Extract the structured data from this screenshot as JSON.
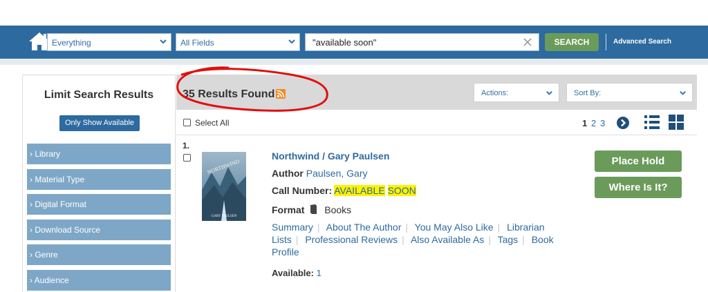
{
  "search_bar": {
    "scope_value": "Everything",
    "field_value": "All Fields",
    "query_value": "\"available soon\"",
    "search_label": "SEARCH",
    "advanced_label": "Advanced Search"
  },
  "sidebar": {
    "title": "Limit Search Results",
    "only_available_label": "Only Show Available",
    "facets": [
      "› Library",
      "› Material Type",
      "› Digital Format",
      "› Download Source",
      "› Genre",
      "› Audience"
    ]
  },
  "results": {
    "count_label": "35 Results Found",
    "actions_label": "Actions:",
    "sort_label": "Sort By:",
    "select_all_label": "Select All",
    "pages": [
      "1",
      "2",
      "3"
    ],
    "current_page": "1"
  },
  "item": {
    "number": "1.",
    "title": "Northwind / Gary Paulsen",
    "author_label": "Author",
    "author_value": "Paulsen, Gary",
    "call_number_label": "Call Number:",
    "call_number_word1": "AVAILABLE",
    "call_number_word2": "SOON",
    "format_label": "Format",
    "format_value": "Books",
    "links": [
      "Summary",
      "About The Author",
      "You May Also Like",
      "Librarian Lists",
      "Professional Reviews",
      "Also Available As",
      "Tags",
      "Book Profile"
    ],
    "available_label": "Available:",
    "available_value": "1",
    "place_hold_label": "Place Hold",
    "where_is_it_label": "Where Is It?",
    "cover_title_text": "NORTHWIND",
    "cover_author_text": "GARY PAULSEN"
  },
  "colors": {
    "brand_blue": "#2d6a9f",
    "action_green": "#6a9b5a",
    "facet_blue": "#7ea7c7",
    "highlight_yellow": "#fff200",
    "annotation_red": "#e01010"
  }
}
